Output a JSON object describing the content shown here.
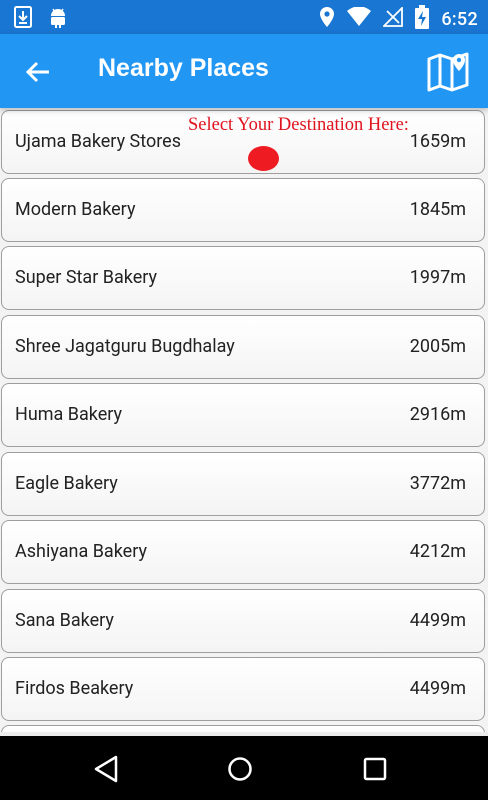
{
  "status_bar": {
    "time": "6:52",
    "icons": [
      "download-icon",
      "android-icon",
      "location-icon",
      "wifi-icon",
      "no-signal-icon",
      "battery-charging-icon"
    ]
  },
  "app_bar": {
    "title": "Nearby Places",
    "back_icon": "arrow-left-icon",
    "map_icon": "map-icon"
  },
  "overlay": {
    "hint": "Select Your Destination Here:",
    "marker_color": "#ee1b22"
  },
  "places": [
    {
      "name": "Ujama Bakery Stores",
      "distance": "1659m"
    },
    {
      "name": "Modern Bakery",
      "distance": "1845m"
    },
    {
      "name": "Super Star Bakery",
      "distance": "1997m"
    },
    {
      "name": "Shree Jagatguru Bugdhalay",
      "distance": "2005m"
    },
    {
      "name": "Huma Bakery",
      "distance": "2916m"
    },
    {
      "name": "Eagle Bakery",
      "distance": "3772m"
    },
    {
      "name": "Ashiyana Bakery",
      "distance": "4212m"
    },
    {
      "name": "Sana Bakery",
      "distance": "4499m"
    },
    {
      "name": "Firdos Beakery",
      "distance": "4499m"
    }
  ],
  "nav_bar": {
    "icons": [
      "back-triangle-icon",
      "home-circle-icon",
      "recents-square-icon"
    ]
  },
  "colors": {
    "status_bar": "#1976d2",
    "app_bar": "#2196f3",
    "hint_text": "#e0141e"
  }
}
